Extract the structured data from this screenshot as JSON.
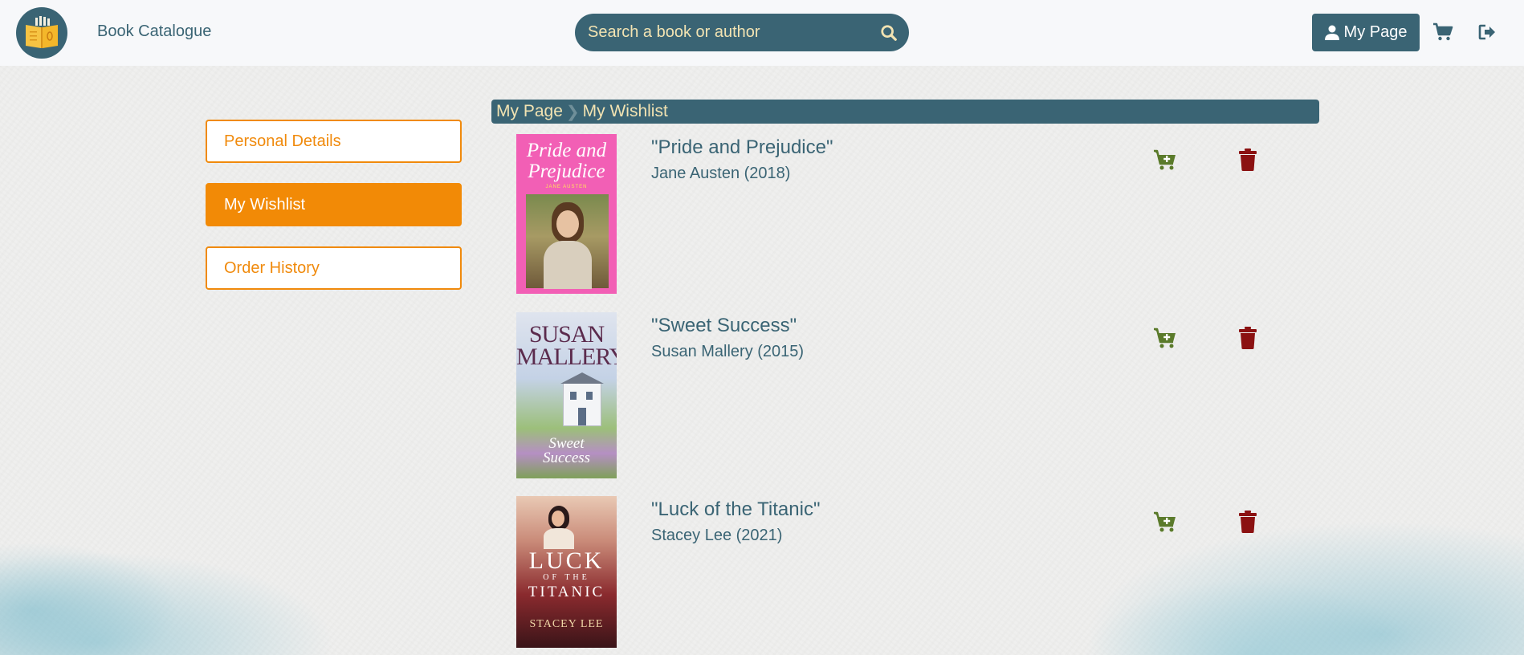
{
  "app": {
    "brand": "Book Catalogue"
  },
  "search": {
    "placeholder": "Search a book or author"
  },
  "header": {
    "my_page_label": "My Page"
  },
  "sidebar": {
    "items": [
      {
        "label": "Personal Details",
        "active": false
      },
      {
        "label": "My Wishlist",
        "active": true
      },
      {
        "label": "Order History",
        "active": false
      }
    ]
  },
  "breadcrumb": {
    "items": [
      "My Page",
      "My Wishlist"
    ]
  },
  "wishlist": [
    {
      "title": "\"Pride and Prejudice\"",
      "author": "Jane Austen (2018)",
      "cover": {
        "line1": "Pride and",
        "line2": "Prejudice",
        "author": "JANE AUSTEN"
      }
    },
    {
      "title": "\"Sweet Success\"",
      "author": "Susan Mallery (2015)",
      "cover": {
        "line1": "SUSAN",
        "line2": "MALLERY",
        "book": "Sweet Success"
      }
    },
    {
      "title": "\"Luck of the Titanic\"",
      "author": "Stacey Lee (2021)",
      "cover": {
        "line1": "LUCK",
        "line2": "OF THE",
        "line3": "TITANIC",
        "author": "STACEY LEE"
      }
    }
  ],
  "colors": {
    "primary": "#3a6474",
    "accent": "#f28a06",
    "cart_green": "#5a7a2a",
    "trash_red": "#8b1111",
    "cream_text": "#f2e3b2"
  },
  "icons": {
    "logo": "open-book-icon",
    "search": "search-icon",
    "user": "user-icon",
    "cart": "cart-icon",
    "logout": "logout-icon",
    "add_to_cart": "cart-plus-icon",
    "delete": "trash-icon"
  }
}
